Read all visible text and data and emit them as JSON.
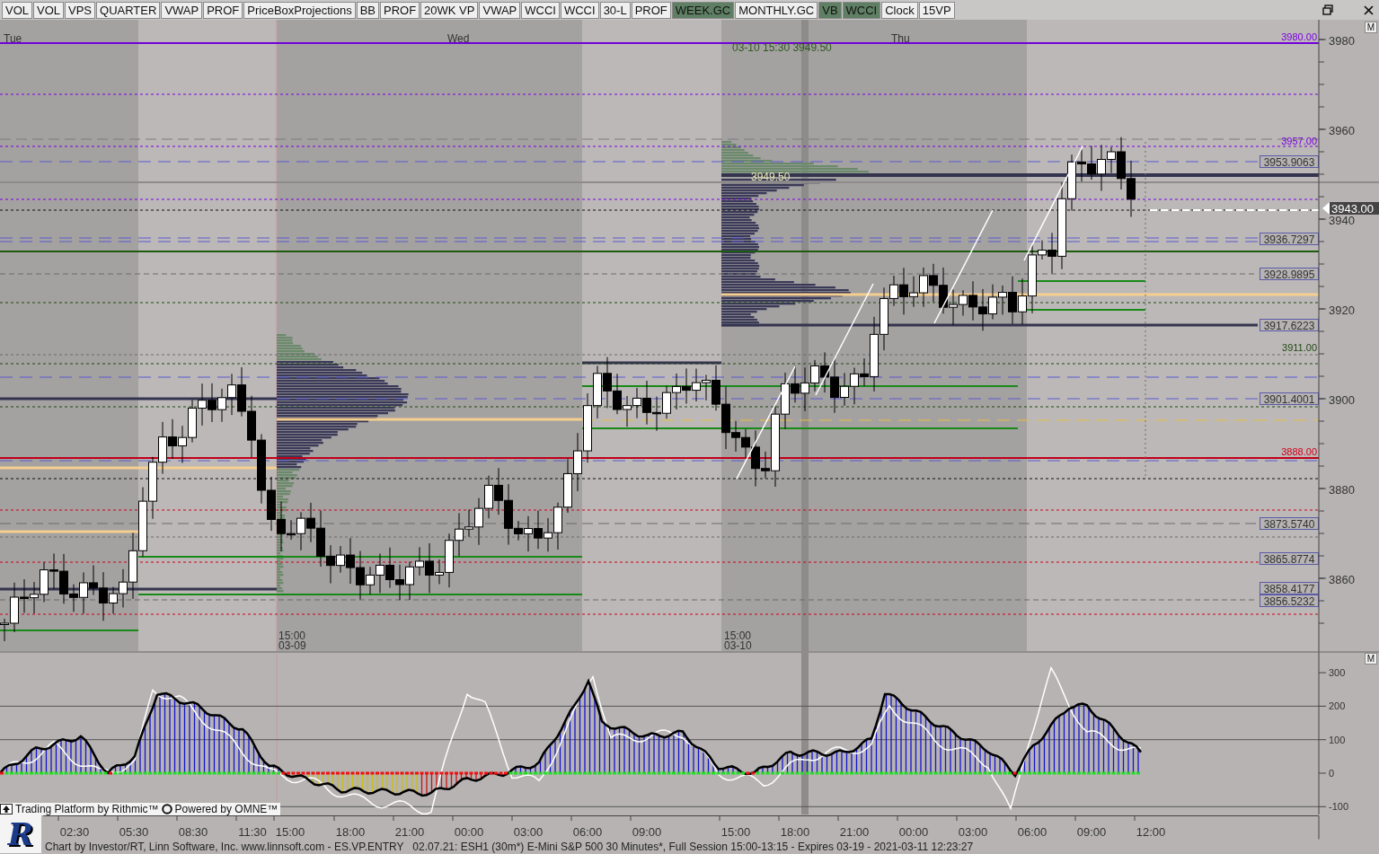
{
  "toolbar": [
    {
      "label": "VOL",
      "selected": false
    },
    {
      "label": "VOL",
      "selected": false
    },
    {
      "label": "VPS",
      "selected": false
    },
    {
      "label": "QUARTER",
      "selected": false
    },
    {
      "label": "VWAP",
      "selected": false
    },
    {
      "label": "PROF",
      "selected": false
    },
    {
      "label": "PriceBoxProjections",
      "selected": false
    },
    {
      "label": "BB",
      "selected": false
    },
    {
      "label": "PROF",
      "selected": false
    },
    {
      "label": "20WK VP",
      "selected": false
    },
    {
      "label": "VWAP",
      "selected": false
    },
    {
      "label": "WCCI",
      "selected": false
    },
    {
      "label": "WCCI",
      "selected": false
    },
    {
      "label": "30-L",
      "selected": false
    },
    {
      "label": "PROF",
      "selected": false
    },
    {
      "label": "WEEK.GC",
      "selected": true
    },
    {
      "label": "MONTHLY.GC",
      "selected": false
    },
    {
      "label": "VB",
      "selected": true
    },
    {
      "label": "WCCI",
      "selected": true
    },
    {
      "label": "Clock",
      "selected": false
    },
    {
      "label": "15VP",
      "selected": false
    }
  ],
  "price_chart": {
    "menu_button": "M",
    "day_labels": [
      "Tue",
      "Wed",
      "Thu"
    ],
    "session_labels": [
      {
        "time": "15:00",
        "date": "03-09"
      },
      {
        "time": "15:00",
        "date": "03-10"
      }
    ],
    "crosshair_label": "03-10 15:30 3949.50",
    "profile_label": "3949.50",
    "level_labels": [
      {
        "text": "3980.00",
        "kind": "plain",
        "color": "#7a00e0"
      },
      {
        "text": "3957.00",
        "kind": "plain",
        "color": "#7a00e0"
      },
      {
        "text": "3953.9063",
        "kind": "boxed",
        "color": "#5a5aa8"
      },
      {
        "text": "3936.7297",
        "kind": "boxed",
        "color": "#5a5aa8"
      },
      {
        "text": "3928.9895",
        "kind": "boxed",
        "color": "#5a5aa8"
      },
      {
        "text": "3917.6223",
        "kind": "boxed",
        "color": "#5a5aa8"
      },
      {
        "text": "3911.00",
        "kind": "plain",
        "color": "#1e4a10"
      },
      {
        "text": "3901.4001",
        "kind": "boxed",
        "color": "#5a5aa8"
      },
      {
        "text": "3888.00",
        "kind": "plain",
        "color": "#d00018"
      },
      {
        "text": "3873.5740",
        "kind": "boxed",
        "color": "#5a5aa8"
      },
      {
        "text": "3865.8774",
        "kind": "boxed",
        "color": "#5a5aa8"
      },
      {
        "text": "3858.4177",
        "kind": "boxed",
        "color": "#5a5aa8"
      },
      {
        "text": "3856.5232",
        "kind": "boxed",
        "color": "#5a5aa8"
      }
    ],
    "axis_labels": [
      "3980",
      "3960",
      "3940",
      "3920",
      "3900",
      "3880",
      "3860"
    ],
    "current_price": "3943.00"
  },
  "oscillator": {
    "menu_button": "M",
    "axis_labels": [
      "300",
      "200",
      "100",
      "0",
      "-100"
    ]
  },
  "branding": {
    "rithmic": "Trading Platform by Rithmic™",
    "omne": "Powered by OMNE™"
  },
  "time_axis": [
    "02:30",
    "05:30",
    "08:30",
    "11:30",
    "15:00",
    "18:00",
    "21:00",
    "00:00",
    "03:00",
    "06:00",
    "09:00",
    "15:00",
    "18:00",
    "21:00",
    "00:00",
    "03:00",
    "06:00",
    "09:00",
    "12:00"
  ],
  "footer": {
    "logo": "R",
    "text": "Chart by Investor/RT, Linn Software, Inc. www.linnsoft.com - ES.VP.ENTRY   02.07.21: ESH1 (30m*) E-Mini S&P 500 30 Minutes*, Full Session 15:00-13:15 - Expires 03-19 - 2021-03-11 12:23:27"
  }
}
